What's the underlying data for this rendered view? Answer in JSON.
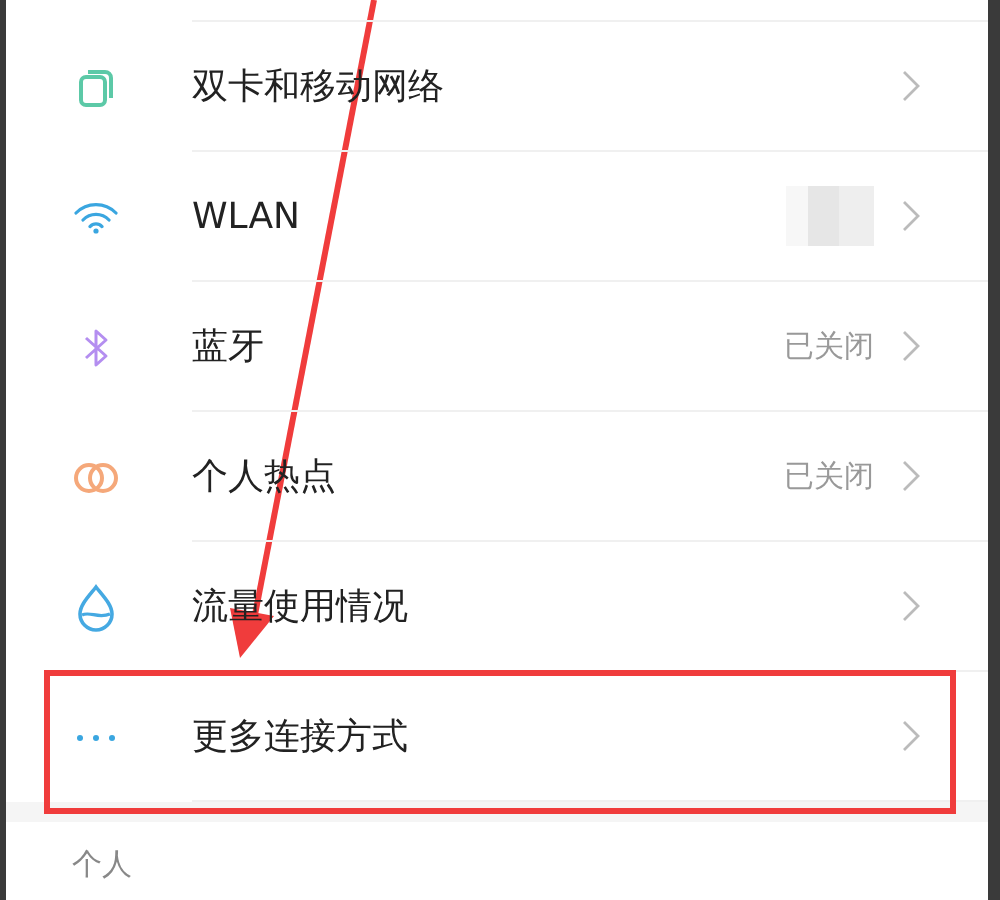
{
  "connection_items": [
    {
      "label": "双卡和移动网络",
      "highlighted": false
    },
    {
      "label": "WLAN",
      "value_blurred": true,
      "highlighted": false
    },
    {
      "label": "蓝牙",
      "value": "已关闭",
      "highlighted": false
    },
    {
      "label": "个人热点",
      "value": "已关闭",
      "highlighted": false
    },
    {
      "label": "流量使用情况",
      "highlighted": false
    },
    {
      "label": "更多连接方式",
      "highlighted": true
    }
  ],
  "section_header": "个人"
}
